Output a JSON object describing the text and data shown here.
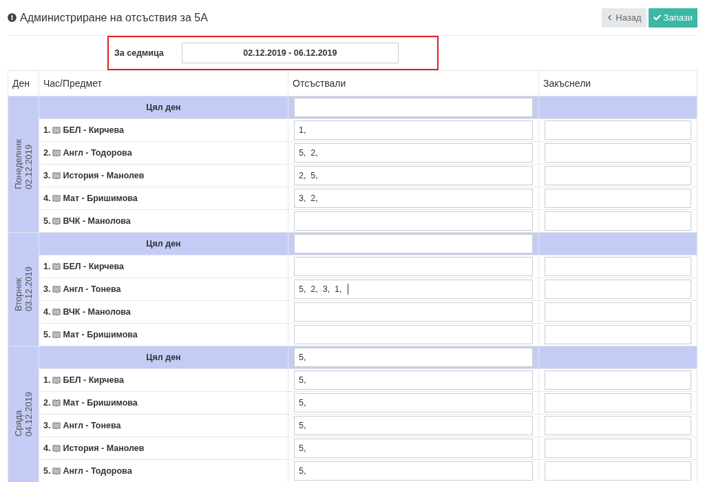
{
  "title": "Администриране на отсъствия за 5А",
  "buttons": [
    {
      "kind": "back",
      "label": "Назад"
    },
    {
      "kind": "save",
      "label": "Запази"
    }
  ],
  "week": {
    "label": "За седмица",
    "value": "02.12.2019 - 06.12.2019"
  },
  "table": {
    "columns": [
      "Ден",
      "Час/Предмет",
      "Отсъствали",
      "Закъснели"
    ],
    "days": [
      {
        "name": "Понеделник",
        "date": "02.12.2019",
        "rows": [
          {
            "kind": "whole_day",
            "label": "Цял ден",
            "absent": ""
          },
          {
            "kind": "lesson",
            "number": "1.",
            "subject": "БЕЛ - Кирчева",
            "absent": "1,",
            "late": ""
          },
          {
            "kind": "lesson",
            "number": "2.",
            "subject": "Англ - Тодорова",
            "absent": "5,  2,",
            "late": ""
          },
          {
            "kind": "lesson",
            "number": "3.",
            "subject": "История - Манолев",
            "absent": "2,  5,",
            "late": ""
          },
          {
            "kind": "lesson",
            "number": "4.",
            "subject": "Мат - Бришимова",
            "absent": "3,  2,",
            "late": ""
          },
          {
            "kind": "lesson",
            "number": "5.",
            "subject": "ВЧК - Манолова",
            "absent": "",
            "late": ""
          }
        ]
      },
      {
        "name": "Вторник",
        "date": "03.12.2019",
        "rows": [
          {
            "kind": "whole_day",
            "label": "Цял ден",
            "absent": ""
          },
          {
            "kind": "lesson",
            "number": "1.",
            "subject": "БЕЛ - Кирчева",
            "absent": "",
            "late": ""
          },
          {
            "kind": "lesson",
            "number": "3.",
            "subject": "Англ - Тонева",
            "absent": "5,  2,  3,  1,",
            "late": "",
            "focused": true
          },
          {
            "kind": "lesson",
            "number": "4.",
            "subject": "ВЧК - Манолова",
            "absent": "",
            "late": ""
          },
          {
            "kind": "lesson",
            "number": "5.",
            "subject": "Мат - Бришимова",
            "absent": "",
            "late": ""
          }
        ]
      },
      {
        "name": "Сряда",
        "date": "04.12.2019",
        "rows": [
          {
            "kind": "whole_day",
            "label": "Цял ден",
            "absent": "5,"
          },
          {
            "kind": "lesson",
            "number": "1.",
            "subject": "БЕЛ - Кирчева",
            "absent": "5,",
            "late": ""
          },
          {
            "kind": "lesson",
            "number": "2.",
            "subject": "Мат - Бришимова",
            "absent": "5,",
            "late": ""
          },
          {
            "kind": "lesson",
            "number": "3.",
            "subject": "Англ - Тонева",
            "absent": "5,",
            "late": ""
          },
          {
            "kind": "lesson",
            "number": "4.",
            "subject": "История - Манолев",
            "absent": "5,",
            "late": ""
          },
          {
            "kind": "lesson",
            "number": "5.",
            "subject": "Англ - Тодорова",
            "absent": "5,",
            "late": ""
          }
        ]
      }
    ]
  }
}
